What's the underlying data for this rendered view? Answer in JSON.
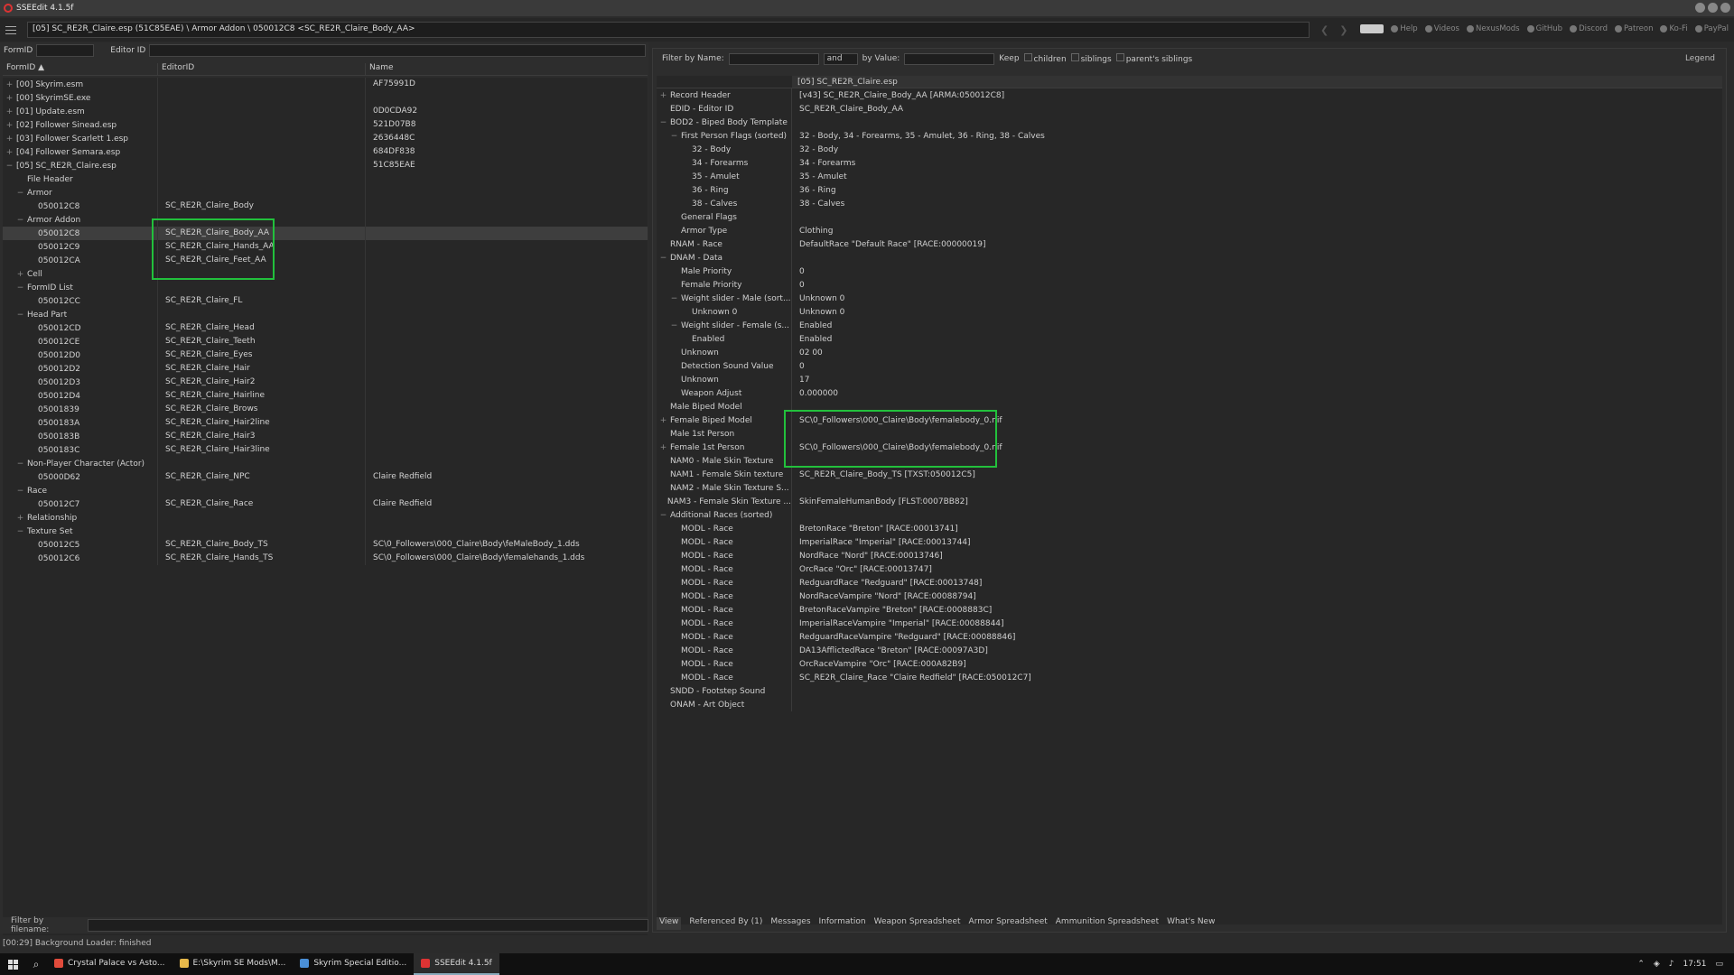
{
  "window": {
    "title": "SSEEdit 4.1.5f"
  },
  "path": "[05] SC_RE2R_Claire.esp (51C85EAE) \\ Armor Addon \\ 050012C8 <SC_RE2R_Claire_Body_AA>",
  "toplinks": [
    "Help",
    "Videos",
    "NexusMods",
    "GitHub",
    "Discord",
    "Patreon",
    "Ko-Fi",
    "PayPal"
  ],
  "left": {
    "formid_label": "FormID",
    "editorid_label": "Editor ID",
    "columns": [
      "FormID ▲",
      "EditorID",
      "Name"
    ],
    "rows": [
      {
        "e": "+",
        "id": "[00] Skyrim.esm",
        "ed": "",
        "nm": "AF75991D",
        "lvl": 0
      },
      {
        "e": "+",
        "id": "[00] SkyrimSE.exe",
        "ed": "",
        "nm": "",
        "lvl": 0
      },
      {
        "e": "+",
        "id": "[01] Update.esm",
        "ed": "",
        "nm": "0D0CDA92",
        "lvl": 0
      },
      {
        "e": "+",
        "id": "[02] Follower Sinead.esp",
        "ed": "",
        "nm": "521D07B8",
        "lvl": 0
      },
      {
        "e": "+",
        "id": "[03] Follower Scarlett 1.esp",
        "ed": "",
        "nm": "2636448C",
        "lvl": 0
      },
      {
        "e": "+",
        "id": "[04] Follower Semara.esp",
        "ed": "",
        "nm": "684DF838",
        "lvl": 0
      },
      {
        "e": "−",
        "id": "[05] SC_RE2R_Claire.esp",
        "ed": "",
        "nm": "51C85EAE",
        "lvl": 0
      },
      {
        "e": "",
        "id": "File Header",
        "ed": "",
        "nm": "",
        "lvl": 1
      },
      {
        "e": "−",
        "id": "Armor",
        "ed": "",
        "nm": "",
        "lvl": 1
      },
      {
        "e": "",
        "id": "050012C8",
        "ed": "SC_RE2R_Claire_Body",
        "nm": "",
        "lvl": 2
      },
      {
        "e": "−",
        "id": "Armor Addon",
        "ed": "",
        "nm": "",
        "lvl": 1
      },
      {
        "e": "",
        "id": "050012C8",
        "ed": "SC_RE2R_Claire_Body_AA",
        "nm": "",
        "lvl": 2,
        "sel": true
      },
      {
        "e": "",
        "id": "050012C9",
        "ed": "SC_RE2R_Claire_Hands_AA",
        "nm": "",
        "lvl": 2
      },
      {
        "e": "",
        "id": "050012CA",
        "ed": "SC_RE2R_Claire_Feet_AA",
        "nm": "",
        "lvl": 2
      },
      {
        "e": "+",
        "id": "Cell",
        "ed": "",
        "nm": "",
        "lvl": 1
      },
      {
        "e": "−",
        "id": "FormID List",
        "ed": "",
        "nm": "",
        "lvl": 1
      },
      {
        "e": "",
        "id": "050012CC",
        "ed": "SC_RE2R_Claire_FL",
        "nm": "",
        "lvl": 2
      },
      {
        "e": "−",
        "id": "Head Part",
        "ed": "",
        "nm": "",
        "lvl": 1
      },
      {
        "e": "",
        "id": "050012CD",
        "ed": "SC_RE2R_Claire_Head",
        "nm": "",
        "lvl": 2
      },
      {
        "e": "",
        "id": "050012CE",
        "ed": "SC_RE2R_Claire_Teeth",
        "nm": "",
        "lvl": 2
      },
      {
        "e": "",
        "id": "050012D0",
        "ed": "SC_RE2R_Claire_Eyes",
        "nm": "",
        "lvl": 2
      },
      {
        "e": "",
        "id": "050012D2",
        "ed": "SC_RE2R_Claire_Hair",
        "nm": "",
        "lvl": 2
      },
      {
        "e": "",
        "id": "050012D3",
        "ed": "SC_RE2R_Claire_Hair2",
        "nm": "",
        "lvl": 2
      },
      {
        "e": "",
        "id": "050012D4",
        "ed": "SC_RE2R_Claire_Hairline",
        "nm": "",
        "lvl": 2
      },
      {
        "e": "",
        "id": "05001839",
        "ed": "SC_RE2R_Claire_Brows",
        "nm": "",
        "lvl": 2
      },
      {
        "e": "",
        "id": "0500183A",
        "ed": "SC_RE2R_Claire_Hair2line",
        "nm": "",
        "lvl": 2
      },
      {
        "e": "",
        "id": "0500183B",
        "ed": "SC_RE2R_Claire_Hair3",
        "nm": "",
        "lvl": 2
      },
      {
        "e": "",
        "id": "0500183C",
        "ed": "SC_RE2R_Claire_Hair3line",
        "nm": "",
        "lvl": 2
      },
      {
        "e": "−",
        "id": "Non-Player Character (Actor)",
        "ed": "",
        "nm": "",
        "lvl": 1
      },
      {
        "e": "",
        "id": "05000D62",
        "ed": "SC_RE2R_Claire_NPC",
        "nm": "Claire Redfield",
        "lvl": 2
      },
      {
        "e": "−",
        "id": "Race",
        "ed": "",
        "nm": "",
        "lvl": 1
      },
      {
        "e": "",
        "id": "050012C7",
        "ed": "SC_RE2R_Claire_Race",
        "nm": "Claire Redfield",
        "lvl": 2
      },
      {
        "e": "+",
        "id": "Relationship",
        "ed": "",
        "nm": "",
        "lvl": 1
      },
      {
        "e": "−",
        "id": "Texture Set",
        "ed": "",
        "nm": "",
        "lvl": 1
      },
      {
        "e": "",
        "id": "050012C5",
        "ed": "SC_RE2R_Claire_Body_TS",
        "nm": "SC\\0_Followers\\000_Claire\\Body\\feMaleBody_1.dds",
        "lvl": 2
      },
      {
        "e": "",
        "id": "050012C6",
        "ed": "SC_RE2R_Claire_Hands_TS",
        "nm": "SC\\0_Followers\\000_Claire\\Body\\femalehands_1.dds",
        "lvl": 2
      }
    ],
    "filter_filename_label": "Filter by filename:"
  },
  "right": {
    "filter": {
      "by_name": "Filter by Name:",
      "op": "and",
      "by_value": "by Value:",
      "keep": "Keep",
      "children": "children",
      "siblings": "siblings",
      "parents_siblings": "parent's siblings",
      "legend": "Legend"
    },
    "header": "[05] SC_RE2R_Claire.esp",
    "rows": [
      {
        "e": "+",
        "k": "Record Header",
        "v": "[v43] SC_RE2R_Claire_Body_AA [ARMA:050012C8]",
        "lvl": 0
      },
      {
        "e": "",
        "k": "EDID - Editor ID",
        "v": "SC_RE2R_Claire_Body_AA",
        "lvl": 0
      },
      {
        "e": "−",
        "k": "BOD2 - Biped Body Template",
        "v": "",
        "lvl": 0
      },
      {
        "e": "−",
        "k": "First Person Flags (sorted)",
        "v": "32 - Body, 34 - Forearms, 35 - Amulet, 36 - Ring, 38 - Calves",
        "lvl": 1
      },
      {
        "e": "",
        "k": "32 - Body",
        "v": "32 - Body",
        "lvl": 2
      },
      {
        "e": "",
        "k": "34 - Forearms",
        "v": "34 - Forearms",
        "lvl": 2
      },
      {
        "e": "",
        "k": "35 - Amulet",
        "v": "35 - Amulet",
        "lvl": 2
      },
      {
        "e": "",
        "k": "36 - Ring",
        "v": "36 - Ring",
        "lvl": 2
      },
      {
        "e": "",
        "k": "38 - Calves",
        "v": "38 - Calves",
        "lvl": 2
      },
      {
        "e": "",
        "k": "General Flags",
        "v": "",
        "lvl": 1
      },
      {
        "e": "",
        "k": "Armor Type",
        "v": "Clothing",
        "lvl": 1
      },
      {
        "e": "",
        "k": "RNAM - Race",
        "v": "DefaultRace \"Default Race\" [RACE:00000019]",
        "lvl": 0
      },
      {
        "e": "−",
        "k": "DNAM - Data",
        "v": "",
        "lvl": 0
      },
      {
        "e": "",
        "k": "Male Priority",
        "v": "0",
        "lvl": 1
      },
      {
        "e": "",
        "k": "Female Priority",
        "v": "0",
        "lvl": 1
      },
      {
        "e": "−",
        "k": "Weight slider - Male (sort...",
        "v": "Unknown 0",
        "lvl": 1
      },
      {
        "e": "",
        "k": "Unknown 0",
        "v": "Unknown 0",
        "lvl": 2
      },
      {
        "e": "−",
        "k": "Weight slider - Female (s...",
        "v": "Enabled",
        "lvl": 1
      },
      {
        "e": "",
        "k": "Enabled",
        "v": "Enabled",
        "lvl": 2
      },
      {
        "e": "",
        "k": "Unknown",
        "v": "02 00",
        "lvl": 1
      },
      {
        "e": "",
        "k": "Detection Sound Value",
        "v": "0",
        "lvl": 1
      },
      {
        "e": "",
        "k": "Unknown",
        "v": "17",
        "lvl": 1
      },
      {
        "e": "",
        "k": "Weapon Adjust",
        "v": "0.000000",
        "lvl": 1
      },
      {
        "e": "",
        "k": "Male Biped Model",
        "v": "",
        "lvl": 0
      },
      {
        "e": "+",
        "k": "Female Biped Model",
        "v": "SC\\0_Followers\\000_Claire\\Body\\femalebody_0.nif",
        "lvl": 0
      },
      {
        "e": "",
        "k": "Male 1st Person",
        "v": "",
        "lvl": 0
      },
      {
        "e": "+",
        "k": "Female 1st Person",
        "v": "SC\\0_Followers\\000_Claire\\Body\\femalebody_0.nif",
        "lvl": 0
      },
      {
        "e": "",
        "k": "NAM0 - Male Skin Texture",
        "v": "",
        "lvl": 0
      },
      {
        "e": "",
        "k": "NAM1 - Female Skin texture",
        "v": "SC_RE2R_Claire_Body_TS [TXST:050012C5]",
        "lvl": 0
      },
      {
        "e": "",
        "k": "NAM2 - Male Skin Texture S...",
        "v": "",
        "lvl": 0
      },
      {
        "e": "",
        "k": "NAM3 - Female Skin Texture ...",
        "v": "SkinFemaleHumanBody [FLST:0007BB82]",
        "lvl": 0
      },
      {
        "e": "−",
        "k": "Additional Races (sorted)",
        "v": "",
        "lvl": 0
      },
      {
        "e": "",
        "k": "MODL - Race",
        "v": "BretonRace \"Breton\" [RACE:00013741]",
        "lvl": 1
      },
      {
        "e": "",
        "k": "MODL - Race",
        "v": "ImperialRace \"Imperial\" [RACE:00013744]",
        "lvl": 1
      },
      {
        "e": "",
        "k": "MODL - Race",
        "v": "NordRace \"Nord\" [RACE:00013746]",
        "lvl": 1
      },
      {
        "e": "",
        "k": "MODL - Race",
        "v": "OrcRace \"Orc\" [RACE:00013747]",
        "lvl": 1
      },
      {
        "e": "",
        "k": "MODL - Race",
        "v": "RedguardRace \"Redguard\" [RACE:00013748]",
        "lvl": 1
      },
      {
        "e": "",
        "k": "MODL - Race",
        "v": "NordRaceVampire \"Nord\" [RACE:00088794]",
        "lvl": 1
      },
      {
        "e": "",
        "k": "MODL - Race",
        "v": "BretonRaceVampire \"Breton\" [RACE:0008883C]",
        "lvl": 1
      },
      {
        "e": "",
        "k": "MODL - Race",
        "v": "ImperialRaceVampire \"Imperial\" [RACE:00088844]",
        "lvl": 1
      },
      {
        "e": "",
        "k": "MODL - Race",
        "v": "RedguardRaceVampire \"Redguard\" [RACE:00088846]",
        "lvl": 1
      },
      {
        "e": "",
        "k": "MODL - Race",
        "v": "DA13AfflictedRace \"Breton\" [RACE:00097A3D]",
        "lvl": 1
      },
      {
        "e": "",
        "k": "MODL - Race",
        "v": "OrcRaceVampire \"Orc\" [RACE:000A82B9]",
        "lvl": 1
      },
      {
        "e": "",
        "k": "MODL - Race",
        "v": "SC_RE2R_Claire_Race \"Claire Redfield\" [RACE:050012C7]",
        "lvl": 1
      },
      {
        "e": "",
        "k": "SNDD - Footstep Sound",
        "v": "",
        "lvl": 0
      },
      {
        "e": "",
        "k": "ONAM - Art Object",
        "v": "",
        "lvl": 0
      }
    ],
    "tabs": [
      "View",
      "Referenced By (1)",
      "Messages",
      "Information",
      "Weapon Spreadsheet",
      "Armor Spreadsheet",
      "Ammunition Spreadsheet",
      "What's New"
    ]
  },
  "status": "[00:29] Background Loader: finished",
  "taskbar": {
    "items": [
      {
        "label": "Crystal Palace vs Asto...",
        "color": "#e14b3b"
      },
      {
        "label": "E:\\Skyrim SE Mods\\M...",
        "color": "#e6b84a"
      },
      {
        "label": "Skyrim Special Editio...",
        "color": "#4a8fd6"
      },
      {
        "label": "SSEEdit 4.1.5f",
        "color": "#d33",
        "active": true
      }
    ],
    "time": "17:51"
  }
}
